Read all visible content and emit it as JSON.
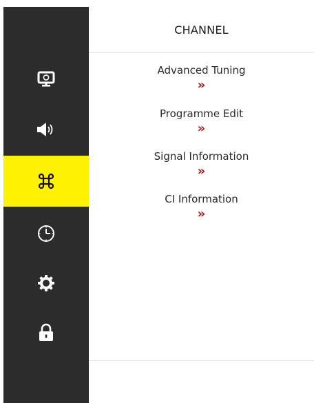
{
  "header": {
    "title": "CHANNEL"
  },
  "sidebar": {
    "items": [
      {
        "icon": "picture-icon",
        "active": false
      },
      {
        "icon": "sound-icon",
        "active": false
      },
      {
        "icon": "channel-icon",
        "active": true
      },
      {
        "icon": "timer-icon",
        "active": false
      },
      {
        "icon": "settings-gear-icon",
        "active": false
      },
      {
        "icon": "lock-icon",
        "active": false
      }
    ],
    "active_color": "#fff200",
    "background_color": "#2c2c2c"
  },
  "menu": {
    "items": [
      {
        "label": "Advanced Tuning",
        "chevron": "»"
      },
      {
        "label": "Programme Edit",
        "chevron": "»"
      },
      {
        "label": "Signal Information",
        "chevron": "»"
      },
      {
        "label": "CI Information",
        "chevron": "»"
      }
    ],
    "chevron_color": "#b01a1a"
  }
}
